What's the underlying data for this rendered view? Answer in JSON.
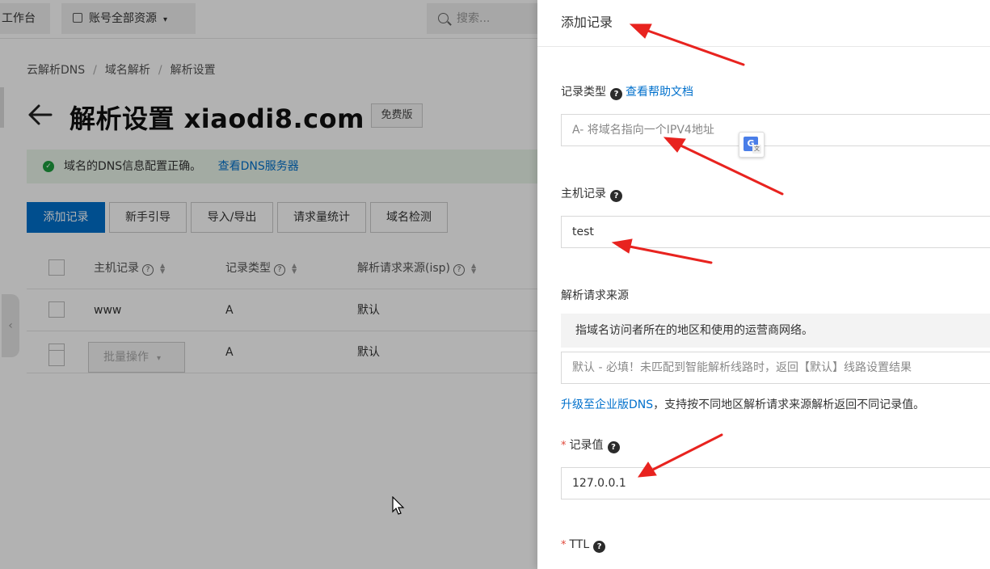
{
  "topbar": {
    "workbench": "工作台",
    "resource": "账号全部资源",
    "search_placeholder": "搜索..."
  },
  "breadcrumb": [
    "云解析DNS",
    "域名解析",
    "解析设置"
  ],
  "breadcrumb_sep": "/",
  "page": {
    "title": "解析设置 xiaodi8.com",
    "edition": "免费版"
  },
  "status": {
    "text": "域名的DNS信息配置正确。",
    "link": "查看DNS服务器"
  },
  "actions": {
    "add": "添加记录",
    "guide": "新手引导",
    "import_export": "导入/导出",
    "stats": "请求量统计",
    "check": "域名检测"
  },
  "table": {
    "columns": [
      "主机记录",
      "记录类型",
      "解析请求来源(isp)"
    ],
    "rows": [
      {
        "host": "www",
        "type": "A",
        "isp": "默认"
      },
      {
        "host": "@",
        "type": "A",
        "isp": "默认"
      }
    ],
    "batch": "批量操作"
  },
  "drawer": {
    "title": "添加记录",
    "record_type_label": "记录类型",
    "help_doc_link": "查看帮助文档",
    "record_type_value": "A- 将域名指向一个IPV4地址",
    "host_label": "主机记录",
    "host_value": "test",
    "isp_label": "解析请求来源",
    "isp_desc": "指域名访问者所在的地区和使用的运营商网络。",
    "isp_value": "默认 - 必填！未匹配到智能解析线路时，返回【默认】线路设置结果",
    "upgrade_link": "升级至企业版DNS",
    "upgrade_text": "，支持按不同地区解析请求来源解析返回不同记录值。",
    "value_label": "记录值",
    "value_value": "127.0.0.1",
    "ttl_label": "TTL",
    "required_mark": "*"
  },
  "icons": {
    "help": "?",
    "check": "✓",
    "collapse": "‹",
    "translate_g": "G",
    "translate_t": "文"
  },
  "colors": {
    "primary": "#0070cc",
    "annotation_arrow": "#e8231f",
    "success": "#1e9e3e"
  }
}
